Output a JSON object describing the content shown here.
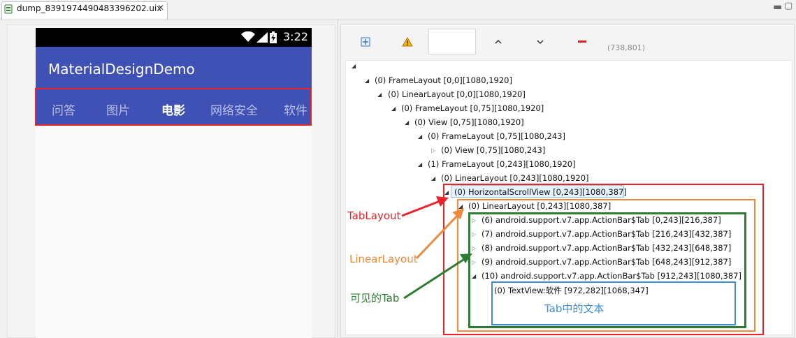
{
  "editor": {
    "tab_title": "dump_8391974490483396202.uix",
    "close_glyph": "✕",
    "min_glyph": "▬",
    "max_glyph": "▢"
  },
  "device": {
    "clock": "3:22",
    "app_title": "MaterialDesignDemo",
    "tabs": [
      {
        "label": "问答",
        "selected": false
      },
      {
        "label": "图片",
        "selected": false
      },
      {
        "label": "电影",
        "selected": true
      },
      {
        "label": "网络安全",
        "selected": false
      },
      {
        "label": "软件",
        "selected": false
      }
    ]
  },
  "toolbar": {
    "coords": "(738,801)",
    "icons": [
      "expand-all-icon",
      "warning-icon",
      "zoom-field",
      "chevron-up-icon",
      "chevron-down-icon",
      "minus-icon"
    ]
  },
  "tree": {
    "nodes": [
      {
        "text": "",
        "state": "expanded"
      },
      {
        "text": "(0) FrameLayout [0,0][1080,1920]",
        "state": "expanded"
      },
      {
        "text": "(0) LinearLayout [0,0][1080,1920]",
        "state": "expanded"
      },
      {
        "text": "(0) FrameLayout [0,75][1080,1920]",
        "state": "expanded"
      },
      {
        "text": "(0) View [0,75][1080,1920]",
        "state": "expanded"
      },
      {
        "text": "(0) FrameLayout [0,75][1080,243]",
        "state": "expanded"
      },
      {
        "text": "(0) View [0,75][1080,243]",
        "state": "collapsed"
      },
      {
        "text": "(1) FrameLayout [0,243][1080,1920]",
        "state": "expanded"
      },
      {
        "text": "(0) LinearLayout [0,243][1080,1920]",
        "state": "expanded"
      },
      {
        "text": "(0) HorizontalScrollView [0,243][1080,387]",
        "state": "expanded",
        "selected": true
      },
      {
        "text": "(0) LinearLayout [0,243][1080,387]",
        "state": "expanded"
      },
      {
        "text": "(6) android.support.v7.app.ActionBar$Tab [0,243][216,387]",
        "state": "collapsed"
      },
      {
        "text": "(7) android.support.v7.app.ActionBar$Tab [216,243][432,387]",
        "state": "collapsed"
      },
      {
        "text": "(8) android.support.v7.app.ActionBar$Tab [432,243][648,387]",
        "state": "collapsed"
      },
      {
        "text": "(9) android.support.v7.app.ActionBar$Tab [648,243][912,387]",
        "state": "collapsed"
      },
      {
        "text": "(10) android.support.v7.app.ActionBar$Tab [912,243][1080,387]",
        "state": "expanded"
      },
      {
        "text": "(0) TextView:软件 [972,282][1068,347]",
        "state": "leaf"
      }
    ]
  },
  "annotations": {
    "tablayout": "TabLayout",
    "linearlayout": "LinearLayout",
    "tab": "可见的Tab",
    "text": "Tab中的文本"
  },
  "colors": {
    "app_primary": "#3f51b5",
    "annotation_red": "#e8232a",
    "annotation_orange": "#f0893a",
    "annotation_green": "#2e7d32",
    "annotation_blue": "#3f8fd6"
  }
}
